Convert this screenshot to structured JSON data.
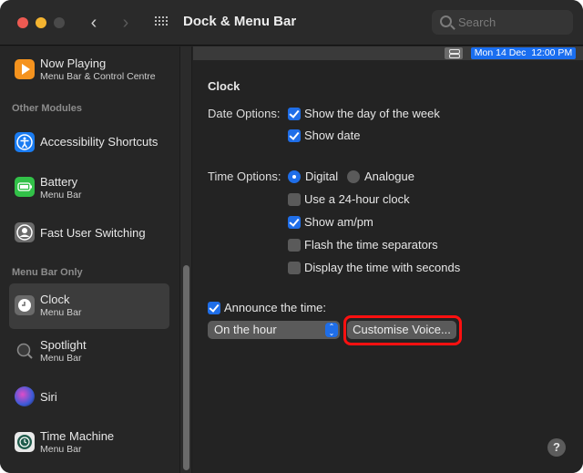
{
  "window": {
    "title": "Dock & Menu Bar",
    "search_placeholder": "Search"
  },
  "sidebar": {
    "top_item": {
      "label": "Now Playing",
      "sub": "Menu Bar & Control Centre",
      "icon": "play-icon",
      "color": "#f5931e"
    },
    "sections": [
      {
        "title": "Other Modules",
        "items": [
          {
            "label": "Accessibility Shortcuts",
            "sub": "",
            "icon": "accessibility-icon",
            "color": "#1a7cf2"
          },
          {
            "label": "Battery",
            "sub": "Menu Bar",
            "icon": "battery-icon",
            "color": "#32c148"
          },
          {
            "label": "Fast User Switching",
            "sub": "",
            "icon": "user-icon",
            "color": "#6a6a6a"
          }
        ]
      },
      {
        "title": "Menu Bar Only",
        "items": [
          {
            "label": "Clock",
            "sub": "Menu Bar",
            "icon": "clock-icon",
            "color": "#6a6a6a",
            "selected": true
          },
          {
            "label": "Spotlight",
            "sub": "Menu Bar",
            "icon": "spotlight-icon",
            "color": "#444444"
          },
          {
            "label": "Siri",
            "sub": "",
            "icon": "siri-icon",
            "color": "#8a3fd1"
          },
          {
            "label": "Time Machine",
            "sub": "Menu Bar",
            "icon": "time-machine-icon",
            "color": "#1f5c4c"
          }
        ]
      }
    ]
  },
  "menubar_preview": {
    "clock_text": "Mon 14 Dec  12:00 PM",
    "accent": "#1a6ef0"
  },
  "clock": {
    "section_title": "Clock",
    "date_options_label": "Date Options:",
    "date_options": [
      {
        "label": "Show the day of the week",
        "checked": true
      },
      {
        "label": "Show date",
        "checked": true
      }
    ],
    "time_options_label": "Time Options:",
    "time_style": [
      {
        "label": "Digital",
        "selected": true
      },
      {
        "label": "Analogue",
        "selected": false
      }
    ],
    "time_options": [
      {
        "label": "Use a 24-hour clock",
        "checked": false
      },
      {
        "label": "Show am/pm",
        "checked": true
      },
      {
        "label": "Flash the time separators",
        "checked": false
      },
      {
        "label": "Display the time with seconds",
        "checked": false
      }
    ],
    "announce": {
      "label": "Announce the time:",
      "checked": true
    },
    "interval_select": "On the hour",
    "customise_button": "Customise Voice..."
  },
  "help_button": "?",
  "colors": {
    "accent": "#1f6ee8",
    "highlight": "#ff1010"
  }
}
